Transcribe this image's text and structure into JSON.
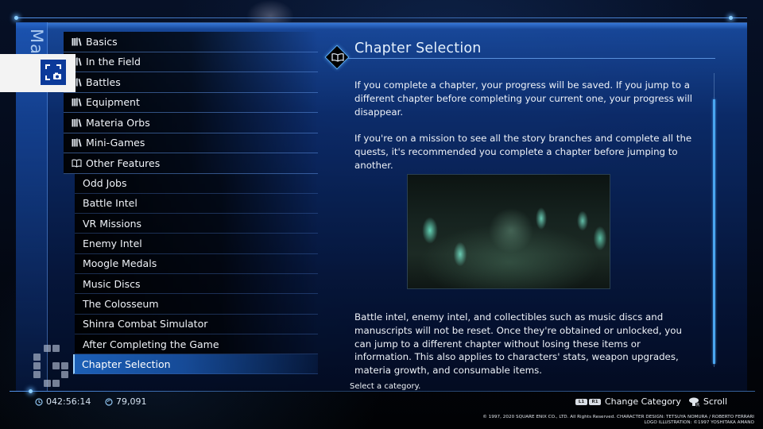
{
  "window": {
    "side_title": "Manual"
  },
  "categories": [
    {
      "label": "Basics",
      "icon": "books-icon"
    },
    {
      "label": "In the Field",
      "icon": "books-icon"
    },
    {
      "label": "Battles",
      "icon": "books-icon"
    },
    {
      "label": "Equipment",
      "icon": "books-icon"
    },
    {
      "label": "Materia Orbs",
      "icon": "books-icon"
    },
    {
      "label": "Mini-Games",
      "icon": "books-icon"
    },
    {
      "label": "Other Features",
      "icon": "open-book-icon",
      "expanded": true
    }
  ],
  "subcategories": [
    {
      "label": "Odd Jobs"
    },
    {
      "label": "Battle Intel"
    },
    {
      "label": "VR Missions"
    },
    {
      "label": "Enemy Intel"
    },
    {
      "label": "Moogle Medals"
    },
    {
      "label": "Music Discs"
    },
    {
      "label": "The Colosseum"
    },
    {
      "label": "Shinra Combat Simulator"
    },
    {
      "label": "After Completing the Game"
    },
    {
      "label": "Chapter Selection",
      "selected": true
    }
  ],
  "content": {
    "title": "Chapter Selection",
    "title_icon": "open-book-icon",
    "paragraphs": [
      "If you complete a chapter, your progress will be saved. If you jump to a different chapter before completing your current one, your progress will disappear.",
      "If you're on a mission to see all the story branches and complete all the quests, it's recommended you complete a chapter before jumping to another."
    ],
    "image_alt": "Midgar city at night with glowing mako reactors",
    "paragraphs_after_image": [
      "Battle intel, enemy intel, and collectibles such as music discs and manuscripts will not be reset. Once they're obtained or unlocked, you can jump to a different chapter without losing these items or information. This also applies to characters' stats, weapon upgrades, materia growth, and consumable items."
    ],
    "scroll_position_fraction": 0.9,
    "scroll_visible_fraction": 0.9
  },
  "status": {
    "hint": "Select a category.",
    "play_time": "042:56:14",
    "gil": "79,091"
  },
  "controls": {
    "l1": "L1",
    "r1": "R1",
    "change_category": "Change Category",
    "scroll": "Scroll"
  },
  "copyright": {
    "line1": "© 1997, 2020 SQUARE ENIX CO., LTD. All Rights Reserved. CHARACTER DESIGN: TETSUYA NOMURA / ROBERTO FERRARI",
    "line2": "LOGO ILLUSTRATION: ©1997 YOSHITAKA AMANO"
  },
  "colors": {
    "accent": "#4aa6f0",
    "selected_bg": "#1e64be",
    "capture_button": "#0b3a9a"
  }
}
